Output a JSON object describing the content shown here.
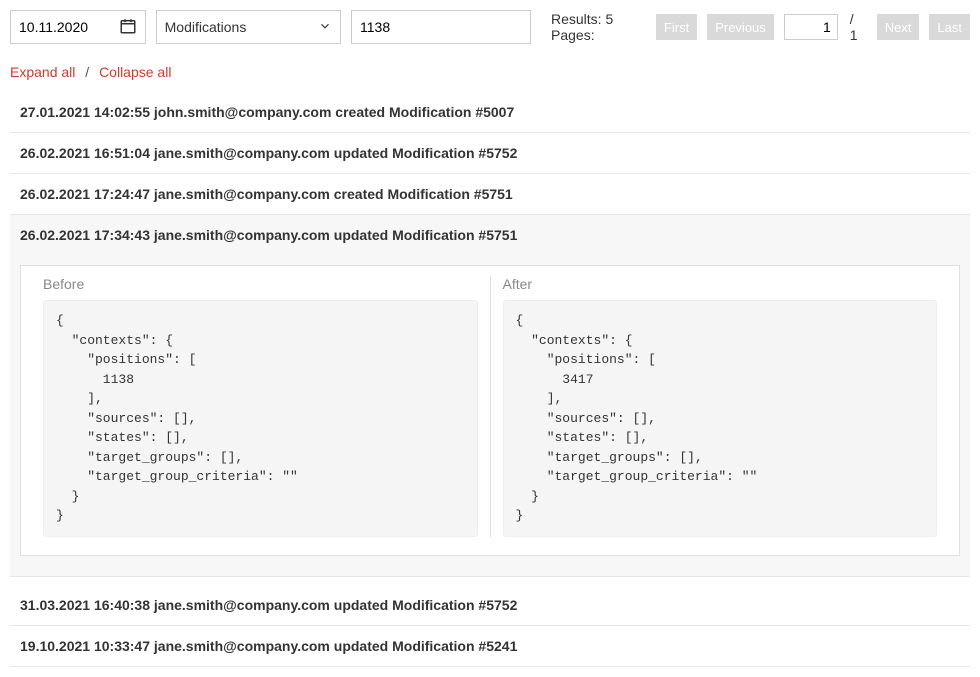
{
  "filters": {
    "date": "10.11.2020",
    "type_selected": "Modifications",
    "search": "1138"
  },
  "pagination": {
    "results_label": "Results: 5 Pages:",
    "first": "First",
    "previous": "Previous",
    "current_page": "1",
    "total_suffix": "/ 1",
    "next": "Next",
    "last": "Last"
  },
  "controls": {
    "expand_all": "Expand all",
    "collapse_all": "Collapse all"
  },
  "detail_labels": {
    "before": "Before",
    "after": "After"
  },
  "entries": [
    {
      "summary": "27.01.2021 14:02:55 john.smith@company.com created Modification #5007"
    },
    {
      "summary": "26.02.2021 16:51:04 jane.smith@company.com updated Modification #5752"
    },
    {
      "summary": "26.02.2021 17:24:47 jane.smith@company.com created Modification #5751"
    },
    {
      "summary": "26.02.2021 17:34:43 jane.smith@company.com updated Modification #5751",
      "expanded": true,
      "before": "{\n  \"contexts\": {\n    \"positions\": [\n      1138\n    ],\n    \"sources\": [],\n    \"states\": [],\n    \"target_groups\": [],\n    \"target_group_criteria\": \"\"\n  }\n}",
      "after": "{\n  \"contexts\": {\n    \"positions\": [\n      3417\n    ],\n    \"sources\": [],\n    \"states\": [],\n    \"target_groups\": [],\n    \"target_group_criteria\": \"\"\n  }\n}"
    },
    {
      "summary": "31.03.2021 16:40:38 jane.smith@company.com updated Modification #5752"
    },
    {
      "summary": "19.10.2021 10:33:47 jane.smith@company.com updated Modification #5241"
    }
  ]
}
